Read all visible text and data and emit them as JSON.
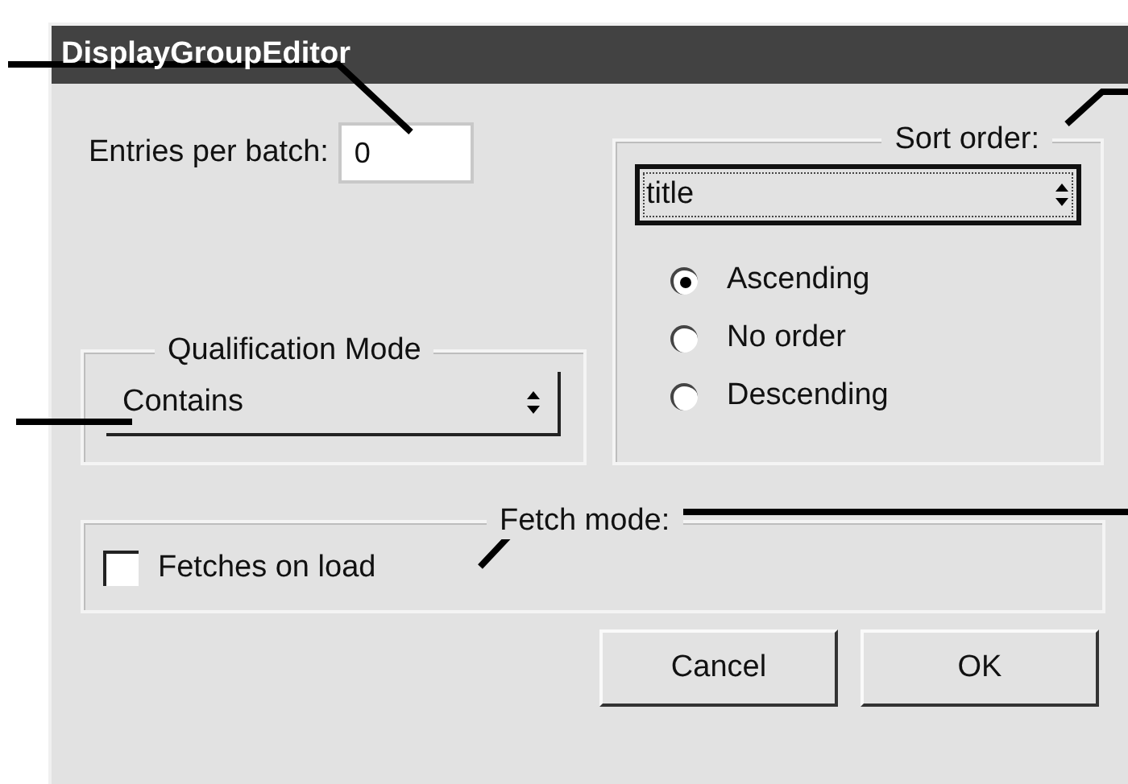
{
  "window": {
    "title": "DisplayGroupEditor"
  },
  "entries_per_batch": {
    "label": "Entries per batch:",
    "value": "0"
  },
  "qualification_mode": {
    "legend": "Qualification Mode",
    "value": "Contains"
  },
  "sort_order": {
    "legend": "Sort order:",
    "value": "title",
    "options": [
      {
        "label": "Ascending",
        "selected": true
      },
      {
        "label": "No order",
        "selected": false
      },
      {
        "label": "Descending",
        "selected": false
      }
    ]
  },
  "fetch_mode": {
    "legend": "Fetch mode:",
    "checkbox": {
      "label": "Fetches on load",
      "checked": false
    }
  },
  "buttons": [
    "Cancel",
    "OK"
  ]
}
